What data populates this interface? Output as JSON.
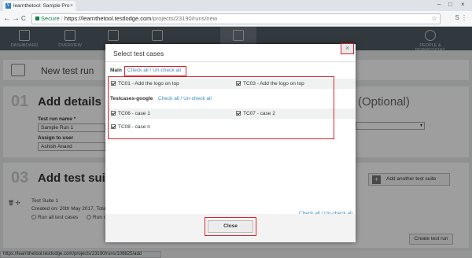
{
  "browser": {
    "tab_title": "learnthetool: Sample Pro",
    "favicon_letter": "V",
    "tab_close": "×",
    "window_controls": [
      "–",
      "□",
      "×"
    ],
    "nav_back": "←",
    "nav_forward": "→",
    "nav_reload": "C",
    "secure_label": "Secure",
    "url_host": "https://learnthetool.testlodge.com",
    "url_path": "/projects/23190/runs/new",
    "star": "☆",
    "extensions": "S ⋮"
  },
  "app_header": {
    "tabs": [
      {
        "label": "DASHBOARD",
        "active": false
      },
      {
        "label": "OVERVIEW",
        "active": false
      },
      {
        "label": "",
        "active": false
      },
      {
        "label": "",
        "active": false
      },
      {
        "label": "",
        "active": true
      },
      {
        "label": "PEOPLE & PERMISSIONS",
        "active": false
      }
    ]
  },
  "page": {
    "title": "New test run",
    "step1": {
      "number": "01",
      "title": "Add details",
      "optional": "(Optional)"
    },
    "run_name_label": "Test run name *",
    "run_name_value": "Sample Run 1",
    "assign_label": "Assign to user",
    "assign_value": "Ashish Anand",
    "select_arrow": "▾",
    "step3": {
      "number": "03",
      "title": "Add test suite"
    },
    "add_suite_button": "Add another test suite",
    "add_suite_plus": "+",
    "suite_name": "Test Suite 1",
    "suite_created": "Created on: 20th May 2017, Total test cases",
    "run_all_label": "Run all test cases",
    "run_selected_label": "Run s",
    "create_button": "Create test run",
    "suite_icons": "🗑 ✣"
  },
  "status_bar": "https://learnthetool.testlodge.com/projects/23190/runs/108825/add",
  "modal": {
    "title": "Select test cases",
    "close_icon": "×",
    "sections": [
      {
        "name": "Main",
        "check_all": "Check all / Un-check all",
        "cases": [
          "TC01 - Add the logo on top",
          "TC03 - Add the logo on top"
        ]
      },
      {
        "name": "Testcases-google",
        "check_all": "Check all / Un-check all",
        "cases": [
          "TC06 - case 1",
          "TC07 - case 2",
          "TC08 - case n"
        ]
      }
    ],
    "footer_check_all": "Check all / Un-check all",
    "close_button": "Close"
  },
  "colors": {
    "highlight": "#d9232a",
    "link": "#3a8ac6",
    "header": "#505c64"
  }
}
